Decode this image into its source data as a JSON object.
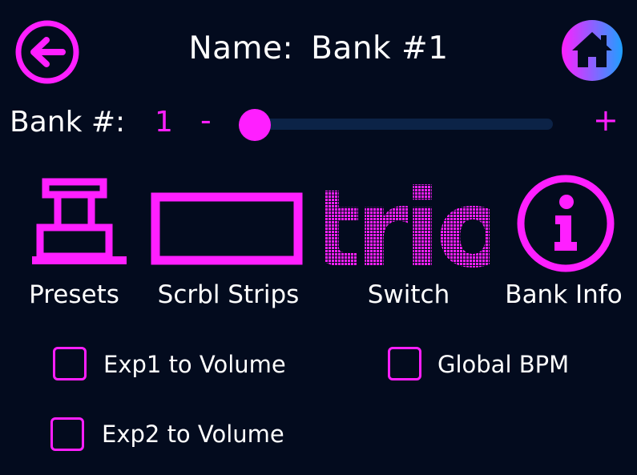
{
  "header": {
    "name_label": "Name:",
    "bank_name": "Bank #1"
  },
  "bank": {
    "label": "Bank #:",
    "value": "1",
    "minus_label": "-",
    "plus_label": "+",
    "slider_value": 1
  },
  "actions": [
    {
      "label": "Presets",
      "icon": "presets-icon"
    },
    {
      "label": "Scrbl Strips",
      "icon": "scribble-strip-icon"
    },
    {
      "label": "Switch",
      "icon": "trio-logo",
      "logo_text": "trio"
    },
    {
      "label": "Bank Info",
      "icon": "info-icon"
    }
  ],
  "options": {
    "exp1_volume": {
      "label": "Exp1 to Volume",
      "checked": false
    },
    "global_bpm": {
      "label": "Global BPM",
      "checked": false
    },
    "exp2_volume": {
      "label": "Exp2 to Volume",
      "checked": false
    }
  },
  "colors": {
    "background": "#030b1e",
    "accent": "#ff1fff",
    "track": "#0c2347",
    "text": "#ffffff",
    "home_gradient_start": "#ff1fff",
    "home_gradient_end": "#1fa0ff"
  }
}
